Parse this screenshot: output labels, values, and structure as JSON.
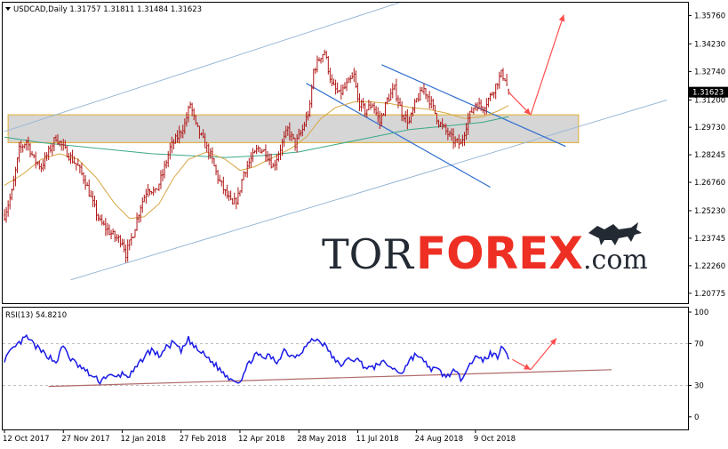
{
  "chart_header": {
    "symbol_line": "USDCAD,Daily  1.31757 1.31811 1.31484 1.31623",
    "rsi_line": "RSI(13) 54.8210"
  },
  "watermark": {
    "part1": "TOR",
    "part2": "FOREX",
    "part3": ".com",
    "logo_icon": "bull-bear-icon"
  },
  "colors": {
    "candle": "#b01818",
    "ma_fast": "#d7a640",
    "ma_slow": "#3aa88a",
    "channel": "#9bb8d6",
    "down_channel": "#2f6fd0",
    "zone_fill": "#c8c8c8",
    "zone_border": "#e3b54d",
    "arrow": "#ff4d4d",
    "rsi": "#1a1ae6",
    "rsi_trend": "#b06a6a",
    "price_tag": "#000000",
    "watermark_dark": "#232a33",
    "watermark_red": "#ee2f24"
  },
  "chart_data": [
    {
      "type": "candlestick",
      "title": "USDCAD,Daily",
      "ohlc_last": {
        "open": 1.31757,
        "high": 1.31811,
        "low": 1.31484,
        "close": 1.31623
      },
      "current_price_label": "1.31623",
      "y_ticks": [
        "1.35760",
        "1.34230",
        "1.32740",
        "1.31200",
        "1.29730",
        "1.28245",
        "1.26760",
        "1.25230",
        "1.23745",
        "1.22260",
        "1.20775"
      ],
      "y_tick_values": [
        1.3576,
        1.3423,
        1.3274,
        1.312,
        1.2973,
        1.28245,
        1.2676,
        1.2523,
        1.23745,
        1.2226,
        1.20775
      ],
      "ylim": [
        1.2024,
        1.3645
      ],
      "x_ticks": [
        "12 Oct 2017",
        "27 Nov 2017",
        "12 Jan 2018",
        "27 Feb 2018",
        "12 Apr 2018",
        "28 May 2018",
        "11 Jul 2018",
        "24 Aug 2018",
        "9 Oct 2018"
      ],
      "x_tick_index": [
        0,
        32,
        64,
        96,
        128,
        160,
        192,
        224,
        256
      ],
      "close_path": [
        [
          0,
          1.25
        ],
        [
          4,
          1.262
        ],
        [
          8,
          1.285
        ],
        [
          12,
          1.29
        ],
        [
          16,
          1.28
        ],
        [
          20,
          1.276
        ],
        [
          24,
          1.284
        ],
        [
          28,
          1.292
        ],
        [
          32,
          1.286
        ],
        [
          36,
          1.281
        ],
        [
          40,
          1.276
        ],
        [
          44,
          1.268
        ],
        [
          48,
          1.256
        ],
        [
          52,
          1.246
        ],
        [
          56,
          1.242
        ],
        [
          60,
          1.238
        ],
        [
          64,
          1.236
        ],
        [
          66,
          1.229
        ],
        [
          70,
          1.24
        ],
        [
          74,
          1.255
        ],
        [
          78,
          1.265
        ],
        [
          82,
          1.262
        ],
        [
          86,
          1.272
        ],
        [
          90,
          1.286
        ],
        [
          94,
          1.292
        ],
        [
          98,
          1.299
        ],
        [
          101,
          1.31
        ],
        [
          104,
          1.298
        ],
        [
          108,
          1.29
        ],
        [
          112,
          1.282
        ],
        [
          116,
          1.27
        ],
        [
          120,
          1.262
        ],
        [
          124,
          1.255
        ],
        [
          127,
          1.26
        ],
        [
          130,
          1.273
        ],
        [
          134,
          1.28
        ],
        [
          138,
          1.286
        ],
        [
          142,
          1.284
        ],
        [
          146,
          1.276
        ],
        [
          150,
          1.286
        ],
        [
          154,
          1.296
        ],
        [
          158,
          1.288
        ],
        [
          162,
          1.296
        ],
        [
          166,
          1.308
        ],
        [
          168,
          1.328
        ],
        [
          172,
          1.336
        ],
        [
          174,
          1.338
        ],
        [
          178,
          1.32
        ],
        [
          182,
          1.315
        ],
        [
          186,
          1.32
        ],
        [
          190,
          1.325
        ],
        [
          192,
          1.312
        ],
        [
          196,
          1.306
        ],
        [
          200,
          1.31
        ],
        [
          204,
          1.3
        ],
        [
          208,
          1.312
        ],
        [
          212,
          1.318
        ],
        [
          216,
          1.305
        ],
        [
          220,
          1.3
        ],
        [
          224,
          1.312
        ],
        [
          228,
          1.318
        ],
        [
          232,
          1.31
        ],
        [
          236,
          1.3
        ],
        [
          240,
          1.295
        ],
        [
          244,
          1.29
        ],
        [
          248,
          1.288
        ],
        [
          252,
          1.302
        ],
        [
          256,
          1.31
        ],
        [
          260,
          1.308
        ],
        [
          264,
          1.314
        ],
        [
          268,
          1.322
        ],
        [
          270,
          1.326
        ],
        [
          272,
          1.324
        ],
        [
          274,
          1.3162
        ]
      ],
      "ma_fast_path": [
        [
          0,
          1.266
        ],
        [
          10,
          1.272
        ],
        [
          20,
          1.28
        ],
        [
          30,
          1.283
        ],
        [
          40,
          1.28
        ],
        [
          50,
          1.27
        ],
        [
          60,
          1.256
        ],
        [
          68,
          1.248
        ],
        [
          76,
          1.249
        ],
        [
          84,
          1.256
        ],
        [
          92,
          1.27
        ],
        [
          100,
          1.28
        ],
        [
          110,
          1.284
        ],
        [
          120,
          1.28
        ],
        [
          128,
          1.274
        ],
        [
          136,
          1.276
        ],
        [
          146,
          1.281
        ],
        [
          156,
          1.286
        ],
        [
          164,
          1.292
        ],
        [
          172,
          1.302
        ],
        [
          180,
          1.308
        ],
        [
          190,
          1.311
        ],
        [
          200,
          1.311
        ],
        [
          210,
          1.31
        ],
        [
          220,
          1.308
        ],
        [
          230,
          1.307
        ],
        [
          240,
          1.305
        ],
        [
          250,
          1.302
        ],
        [
          260,
          1.303
        ],
        [
          268,
          1.306
        ],
        [
          274,
          1.309
        ]
      ],
      "ma_slow_path": [
        [
          0,
          1.292
        ],
        [
          20,
          1.289
        ],
        [
          40,
          1.287
        ],
        [
          60,
          1.285
        ],
        [
          80,
          1.283
        ],
        [
          100,
          1.282
        ],
        [
          120,
          1.281
        ],
        [
          140,
          1.282
        ],
        [
          160,
          1.284
        ],
        [
          180,
          1.288
        ],
        [
          200,
          1.292
        ],
        [
          220,
          1.296
        ],
        [
          240,
          1.298
        ],
        [
          260,
          1.3
        ],
        [
          274,
          1.303
        ]
      ],
      "channel_upper": [
        [
          0,
          1.295
        ],
        [
          250,
          1.376
        ]
      ],
      "channel_lower": [
        [
          36,
          1.215
        ],
        [
          360,
          1.312
        ]
      ],
      "down_channel_upper": [
        [
          205,
          1.331
        ],
        [
          305,
          1.287
        ]
      ],
      "down_channel_lower": [
        [
          164,
          1.321
        ],
        [
          264,
          1.265
        ]
      ],
      "zone": {
        "x_from": 2,
        "x_to": 312,
        "y_from": 1.289,
        "y_to": 1.304
      },
      "forecast_arrows": [
        {
          "from": [
            274,
            1.3162
          ],
          "to": [
            286,
            1.304
          ]
        },
        {
          "from": [
            286,
            1.304
          ],
          "to": [
            304,
            1.358
          ]
        }
      ]
    },
    {
      "type": "line",
      "title": "RSI(13)",
      "value": 54.821,
      "ylim": [
        0,
        100
      ],
      "y_ticks": [
        "100",
        "70",
        "30",
        "0"
      ],
      "y_tick_values": [
        100,
        70,
        30,
        0
      ],
      "rsi_path": [
        [
          0,
          55
        ],
        [
          4,
          63
        ],
        [
          8,
          70
        ],
        [
          12,
          76
        ],
        [
          16,
          69
        ],
        [
          20,
          62
        ],
        [
          24,
          58
        ],
        [
          28,
          52
        ],
        [
          32,
          68
        ],
        [
          36,
          55
        ],
        [
          40,
          49
        ],
        [
          44,
          44
        ],
        [
          48,
          38
        ],
        [
          52,
          34
        ],
        [
          56,
          40
        ],
        [
          60,
          37
        ],
        [
          64,
          41
        ],
        [
          68,
          39
        ],
        [
          72,
          47
        ],
        [
          76,
          58
        ],
        [
          80,
          64
        ],
        [
          84,
          58
        ],
        [
          88,
          66
        ],
        [
          92,
          71
        ],
        [
          96,
          62
        ],
        [
          100,
          74
        ],
        [
          104,
          65
        ],
        [
          108,
          60
        ],
        [
          112,
          54
        ],
        [
          116,
          47
        ],
        [
          120,
          40
        ],
        [
          124,
          36
        ],
        [
          128,
          34
        ],
        [
          132,
          48
        ],
        [
          136,
          60
        ],
        [
          140,
          56
        ],
        [
          144,
          58
        ],
        [
          148,
          52
        ],
        [
          152,
          64
        ],
        [
          156,
          58
        ],
        [
          160,
          60
        ],
        [
          164,
          68
        ],
        [
          168,
          74
        ],
        [
          172,
          72
        ],
        [
          176,
          64
        ],
        [
          180,
          52
        ],
        [
          184,
          50
        ],
        [
          188,
          56
        ],
        [
          192,
          54
        ],
        [
          196,
          48
        ],
        [
          200,
          46
        ],
        [
          204,
          52
        ],
        [
          208,
          50
        ],
        [
          212,
          45
        ],
        [
          216,
          42
        ],
        [
          220,
          54
        ],
        [
          224,
          60
        ],
        [
          228,
          52
        ],
        [
          232,
          46
        ],
        [
          236,
          44
        ],
        [
          240,
          38
        ],
        [
          244,
          44
        ],
        [
          248,
          36
        ],
        [
          252,
          50
        ],
        [
          256,
          56
        ],
        [
          260,
          54
        ],
        [
          264,
          60
        ],
        [
          268,
          58
        ],
        [
          270,
          68
        ],
        [
          272,
          66
        ],
        [
          274,
          54.8
        ]
      ],
      "trendline": [
        [
          24,
          29
        ],
        [
          330,
          45
        ]
      ],
      "forecast_arrows": [
        {
          "from": [
            276,
            54.8
          ],
          "to": [
            286,
            45
          ]
        },
        {
          "from": [
            286,
            45
          ],
          "to": [
            300,
            75
          ]
        }
      ]
    }
  ]
}
